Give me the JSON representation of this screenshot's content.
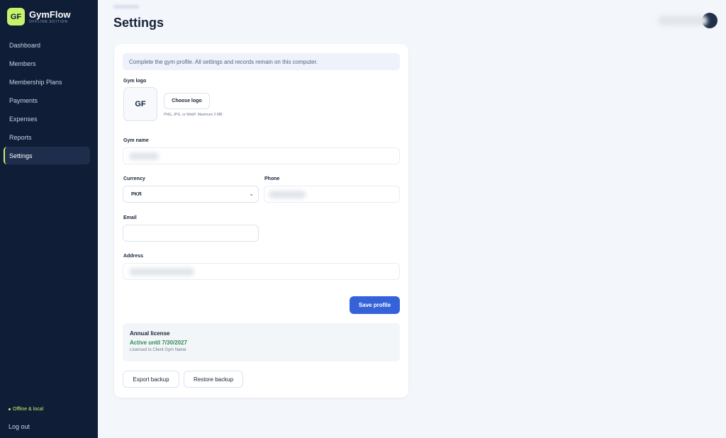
{
  "brand": {
    "initials": "GF",
    "name": "GymFlow",
    "edition": "OFFLINE EDITION"
  },
  "nav": {
    "items": [
      {
        "label": "Dashboard",
        "active": false
      },
      {
        "label": "Members",
        "active": false
      },
      {
        "label": "Membership Plans",
        "active": false
      },
      {
        "label": "Payments",
        "active": false
      },
      {
        "label": "Expenses",
        "active": false
      },
      {
        "label": "Reports",
        "active": false
      },
      {
        "label": "Settings",
        "active": true
      }
    ]
  },
  "sidebar_footer": {
    "status": "Offline & local",
    "logout": "Log out"
  },
  "page": {
    "title": "Settings"
  },
  "profile": {
    "notice": "Complete the gym profile. All settings and records remain on this computer.",
    "logo_label": "Gym logo",
    "logo_initials": "GF",
    "choose_logo": "Choose logo",
    "logo_hint": "PNG, JPG, or WebP. Maximum 2 MB.",
    "gym_name_label": "Gym name",
    "currency_label": "Currency",
    "currency_value": "PKR",
    "phone_label": "Phone",
    "email_label": "Email",
    "email_value": "",
    "address_label": "Address",
    "save": "Save profile"
  },
  "license": {
    "title": "Annual license",
    "status": "Active until 7/30/2027",
    "holder": "Licensed to Client Gym Name",
    "status_color": "#2f8a57"
  },
  "backup": {
    "export": "Export backup",
    "restore": "Restore backup"
  },
  "colors": {
    "sidebar": "#0f1d36",
    "accent": "#c6f36b",
    "primary": "#3562d9",
    "background": "#f3f6fa"
  }
}
